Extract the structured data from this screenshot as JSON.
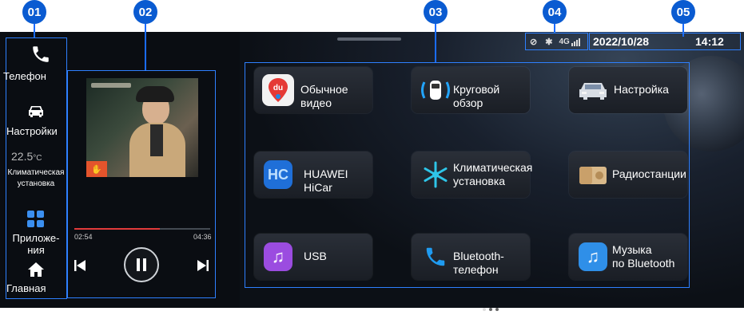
{
  "callouts": [
    "01",
    "02",
    "03",
    "04",
    "05"
  ],
  "status": {
    "date": "2022/10/28",
    "time": "14:12",
    "signal": "4G"
  },
  "sidebar": {
    "phone": "Телефон",
    "settings": "Настройки",
    "temp": "22.5",
    "temp_unit": "°C",
    "climate1": "Климатическая",
    "climate2": "установка",
    "apps1": "Приложе-",
    "apps2": "ния",
    "home": "Главная"
  },
  "player": {
    "elapsed": "02:54",
    "total": "04:36",
    "progress": 0.63
  },
  "tiles": [
    {
      "label": "Обычное видео",
      "icon": "du-video-icon"
    },
    {
      "label": "Круговой обзор",
      "icon": "surround-view-icon"
    },
    {
      "label": "Настройка",
      "icon": "car-settings-icon"
    },
    {
      "label": "HUAWEI HiCar",
      "icon": "hicar-icon"
    },
    {
      "label1": "Климатическая",
      "label2": "установка",
      "icon": "climate-snowflake-icon"
    },
    {
      "label": "Радиостанции",
      "icon": "radio-icon"
    },
    {
      "label": "USB",
      "icon": "usb-music-icon"
    },
    {
      "label": "Bluetooth-телефон",
      "icon": "bluetooth-phone-icon"
    },
    {
      "label1": "Музыка",
      "label2": "по Bluetooth",
      "icon": "bluetooth-music-icon"
    }
  ],
  "colors": {
    "callout": "#0a5bd1",
    "frame": "#2e80ff",
    "progress": "#e23b3b"
  }
}
